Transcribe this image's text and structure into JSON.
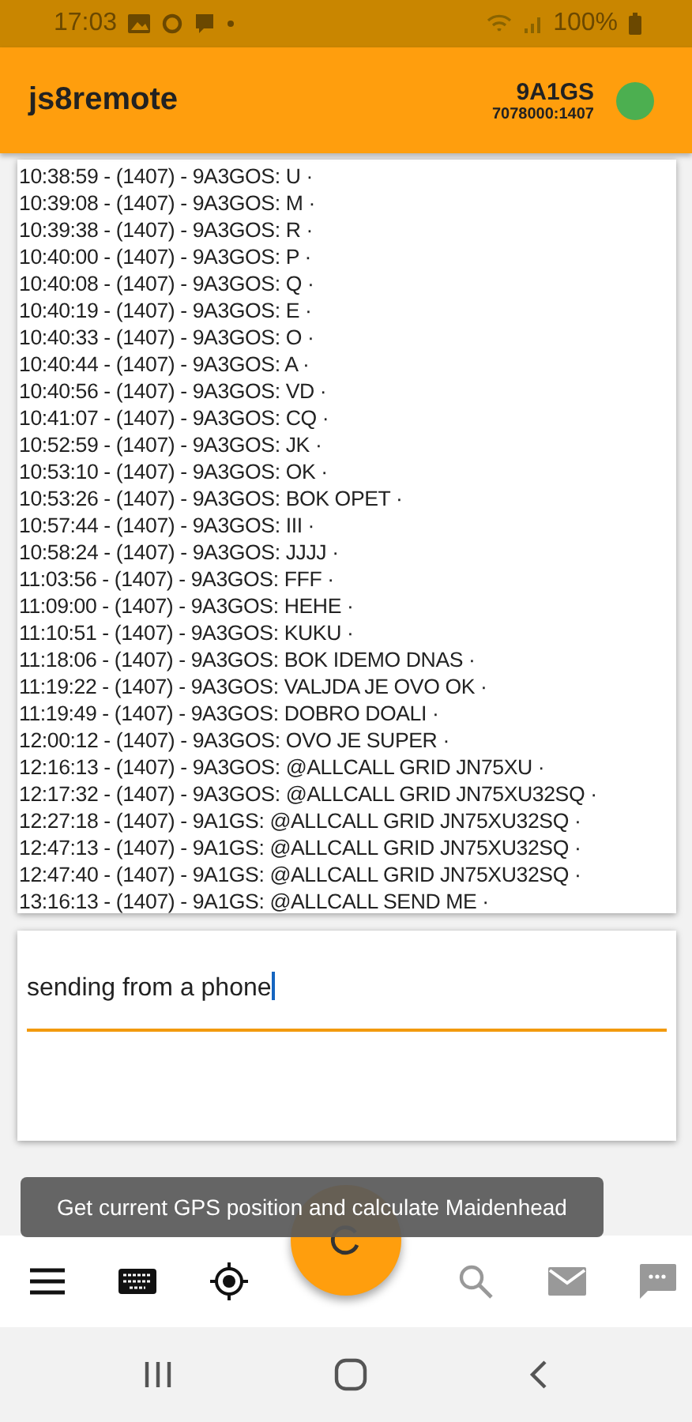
{
  "status_bar": {
    "time": "17:03",
    "battery": "100%"
  },
  "app_bar": {
    "title": "js8remote",
    "callsign": "9A1GS",
    "frequency": "7078000:1407",
    "connected": true
  },
  "log": [
    "10:38:59 - (1407) - 9A3GOS: U ·",
    "10:39:08 - (1407) - 9A3GOS: M ·",
    "10:39:38 - (1407) - 9A3GOS: R ·",
    "10:40:00 - (1407) - 9A3GOS: P ·",
    "10:40:08 - (1407) - 9A3GOS: Q ·",
    "10:40:19 - (1407) - 9A3GOS: E ·",
    "10:40:33 - (1407) - 9A3GOS: O ·",
    "10:40:44 - (1407) - 9A3GOS: A ·",
    "10:40:56 - (1407) - 9A3GOS: VD ·",
    "10:41:07 - (1407) - 9A3GOS: CQ   ·",
    "10:52:59 - (1407) - 9A3GOS: JK ·",
    "10:53:10 - (1407) - 9A3GOS: OK ·",
    "10:53:26 - (1407) - 9A3GOS: BOK OPET ·",
    "10:57:44 - (1407) - 9A3GOS: III ·",
    "10:58:24 - (1407) - 9A3GOS: JJJJ ·",
    "11:03:56 - (1407) - 9A3GOS: FFF ·",
    "11:09:00 - (1407) - 9A3GOS: HEHE ·",
    "11:10:51 - (1407) - 9A3GOS: KUKU ·",
    "11:18:06 - (1407) - 9A3GOS: BOK IDEMO DNAS ·",
    "11:19:22 - (1407) - 9A3GOS: VALJDA JE OVO OK ·",
    "11:19:49 - (1407) - 9A3GOS: DOBRO DOALI ·",
    "12:00:12 - (1407) - 9A3GOS: OVO JE SUPER ·",
    "12:16:13 - (1407) - 9A3GOS: @ALLCALL GRID JN75XU ·",
    "12:17:32 - (1407) - 9A3GOS: @ALLCALL GRID JN75XU32SQ ·",
    "12:27:18 - (1407) - 9A1GS: @ALLCALL GRID JN75XU32SQ ·",
    "12:47:13 - (1407) - 9A1GS: @ALLCALL GRID JN75XU32SQ ·",
    "12:47:40 - (1407) - 9A1GS: @ALLCALL GRID JN75XU32SQ ·",
    "13:16:13 - (1407) - 9A1GS: @ALLCALL  SEND ME ·"
  ],
  "message_field": {
    "value": "sending from a phone"
  },
  "tooltip": "Get current GPS position and calculate Maidenhead",
  "toolbar": [
    {
      "kind": "menu",
      "disabled": false
    },
    {
      "kind": "keyboard",
      "disabled": false
    },
    {
      "kind": "location",
      "disabled": false
    },
    {
      "kind": "fab",
      "disabled": false
    },
    {
      "kind": "search",
      "disabled": true
    },
    {
      "kind": "mail",
      "disabled": true
    },
    {
      "kind": "chat",
      "disabled": true
    }
  ],
  "nav_bar": [
    {
      "kind": "recents"
    },
    {
      "kind": "home"
    },
    {
      "kind": "back"
    }
  ]
}
